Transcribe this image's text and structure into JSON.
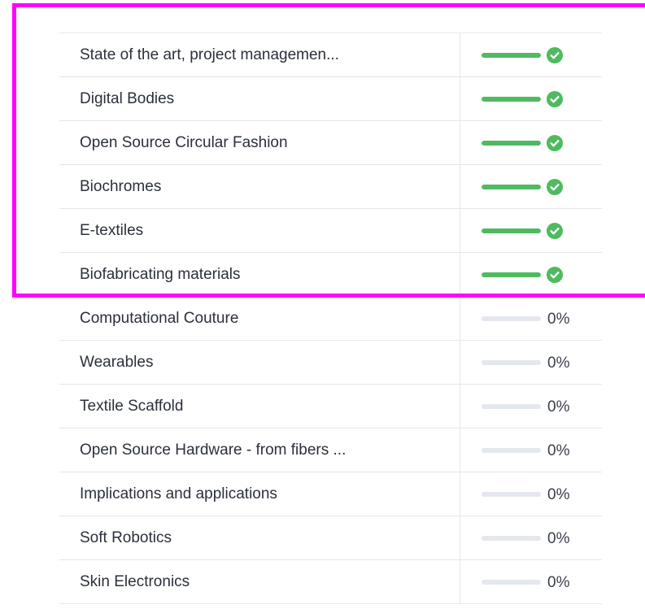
{
  "colors": {
    "complete": "#4fba5f",
    "track": "#e4e8ee",
    "highlight": "#ff00ff"
  },
  "courses": [
    {
      "name": "State of the art, project managemen...",
      "progress": 1.0,
      "status": "complete",
      "percent_label": ""
    },
    {
      "name": "Digital Bodies",
      "progress": 1.0,
      "status": "complete",
      "percent_label": ""
    },
    {
      "name": "Open Source Circular Fashion",
      "progress": 1.0,
      "status": "complete",
      "percent_label": ""
    },
    {
      "name": "Biochromes",
      "progress": 1.0,
      "status": "complete",
      "percent_label": ""
    },
    {
      "name": "E-textiles",
      "progress": 1.0,
      "status": "complete",
      "percent_label": ""
    },
    {
      "name": "Biofabricating materials",
      "progress": 1.0,
      "status": "complete",
      "percent_label": ""
    },
    {
      "name": "Computational Couture",
      "progress": 0,
      "status": "not-started",
      "percent_label": "0%"
    },
    {
      "name": "Wearables",
      "progress": 0,
      "status": "not-started",
      "percent_label": "0%"
    },
    {
      "name": "Textile Scaffold",
      "progress": 0,
      "status": "not-started",
      "percent_label": "0%"
    },
    {
      "name": "Open Source Hardware - from fibers ...",
      "progress": 0,
      "status": "not-started",
      "percent_label": "0%"
    },
    {
      "name": "Implications and applications",
      "progress": 0,
      "status": "not-started",
      "percent_label": "0%"
    },
    {
      "name": "Soft Robotics",
      "progress": 0,
      "status": "not-started",
      "percent_label": "0%"
    },
    {
      "name": "Skin Electronics",
      "progress": 0,
      "status": "not-started",
      "percent_label": "0%"
    }
  ],
  "icons": {
    "complete": "check-circle-icon"
  }
}
